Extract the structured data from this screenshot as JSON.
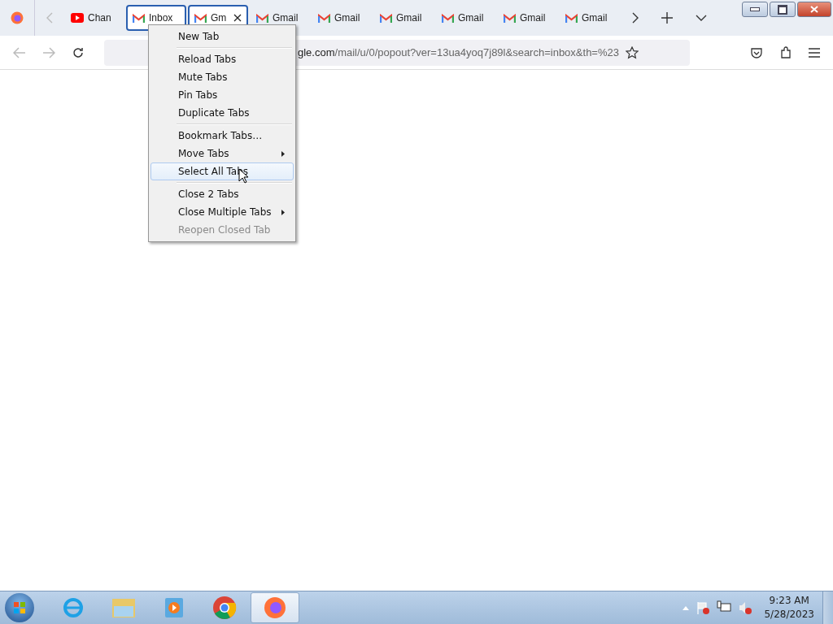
{
  "tabs": [
    {
      "label": "Chan",
      "kind": "youtube",
      "selected": false,
      "closable": false
    },
    {
      "label": "Inbox",
      "kind": "gmail",
      "selected": true,
      "closable": false
    },
    {
      "label": "Gm",
      "kind": "gmail",
      "selected": true,
      "closable": true
    },
    {
      "label": "Gmail",
      "kind": "gmail",
      "selected": false,
      "closable": false
    },
    {
      "label": "Gmail",
      "kind": "gmail",
      "selected": false,
      "closable": false
    },
    {
      "label": "Gmail",
      "kind": "gmail",
      "selected": false,
      "closable": false
    },
    {
      "label": "Gmail",
      "kind": "gmail",
      "selected": false,
      "closable": false
    },
    {
      "label": "Gmail",
      "kind": "gmail",
      "selected": false,
      "closable": false
    },
    {
      "label": "Gmail",
      "kind": "gmail",
      "selected": false,
      "closable": false
    }
  ],
  "address_bar": {
    "host": "gle.com",
    "path": "/mail/u/0/popout?ver=13ua4yoq7j89l&search=inbox&th=%23"
  },
  "context_menu": [
    {
      "kind": "item",
      "label": "New Tab",
      "selected": false,
      "disabled": false,
      "submenu": false
    },
    {
      "kind": "separator"
    },
    {
      "kind": "item",
      "label": "Reload Tabs",
      "selected": false,
      "disabled": false,
      "submenu": false
    },
    {
      "kind": "item",
      "label": "Mute Tabs",
      "selected": false,
      "disabled": false,
      "submenu": false
    },
    {
      "kind": "item",
      "label": "Pin Tabs",
      "selected": false,
      "disabled": false,
      "submenu": false
    },
    {
      "kind": "item",
      "label": "Duplicate Tabs",
      "selected": false,
      "disabled": false,
      "submenu": false
    },
    {
      "kind": "separator"
    },
    {
      "kind": "item",
      "label": "Bookmark Tabs…",
      "selected": false,
      "disabled": false,
      "submenu": false
    },
    {
      "kind": "item",
      "label": "Move Tabs",
      "selected": false,
      "disabled": false,
      "submenu": true
    },
    {
      "kind": "item",
      "label": "Select All Tabs",
      "selected": true,
      "disabled": false,
      "submenu": false
    },
    {
      "kind": "separator"
    },
    {
      "kind": "item",
      "label": "Close 2 Tabs",
      "selected": false,
      "disabled": false,
      "submenu": false
    },
    {
      "kind": "item",
      "label": "Close Multiple Tabs",
      "selected": false,
      "disabled": false,
      "submenu": true
    },
    {
      "kind": "item",
      "label": "Reopen Closed Tab",
      "selected": false,
      "disabled": true,
      "submenu": false
    }
  ],
  "taskbar": {
    "apps": [
      {
        "kind": "ie",
        "selected": false
      },
      {
        "kind": "explorer",
        "selected": false
      },
      {
        "kind": "media",
        "selected": false
      },
      {
        "kind": "chrome",
        "selected": false
      },
      {
        "kind": "firefox",
        "selected": true
      }
    ],
    "time": "9:23 AM",
    "date": "5/28/2023"
  }
}
